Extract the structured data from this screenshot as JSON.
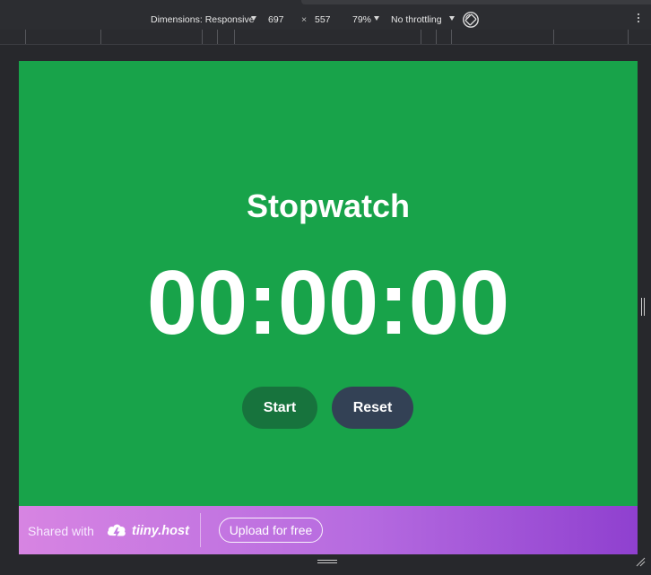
{
  "devtools": {
    "dimensions_label": "Dimensions: Responsive",
    "width_value": "697",
    "times_symbol": "×",
    "height_value": "557",
    "zoom_label": "79%",
    "throttling_label": "No throttling"
  },
  "stopwatch": {
    "title": "Stopwatch",
    "time": "00:00:00",
    "start_label": "Start",
    "reset_label": "Reset"
  },
  "banner": {
    "shared_with": "Shared with",
    "brand": "tiiny.host",
    "upload_label": "Upload for free"
  },
  "colors": {
    "page_background": "#18a34a",
    "start_button": "#17733d",
    "reset_button": "#334155",
    "banner_gradient_start": "#d784e2",
    "banner_gradient_end": "#8f40cf"
  },
  "icons": {
    "dimensions_dropdown": "caret-down-icon",
    "zoom_dropdown": "caret-down-icon",
    "throttling_dropdown": "caret-down-icon",
    "rotate": "rotate-icon",
    "more": "more-vertical-icon",
    "tiiny_logo": "tiiny-host-logo-icon"
  }
}
